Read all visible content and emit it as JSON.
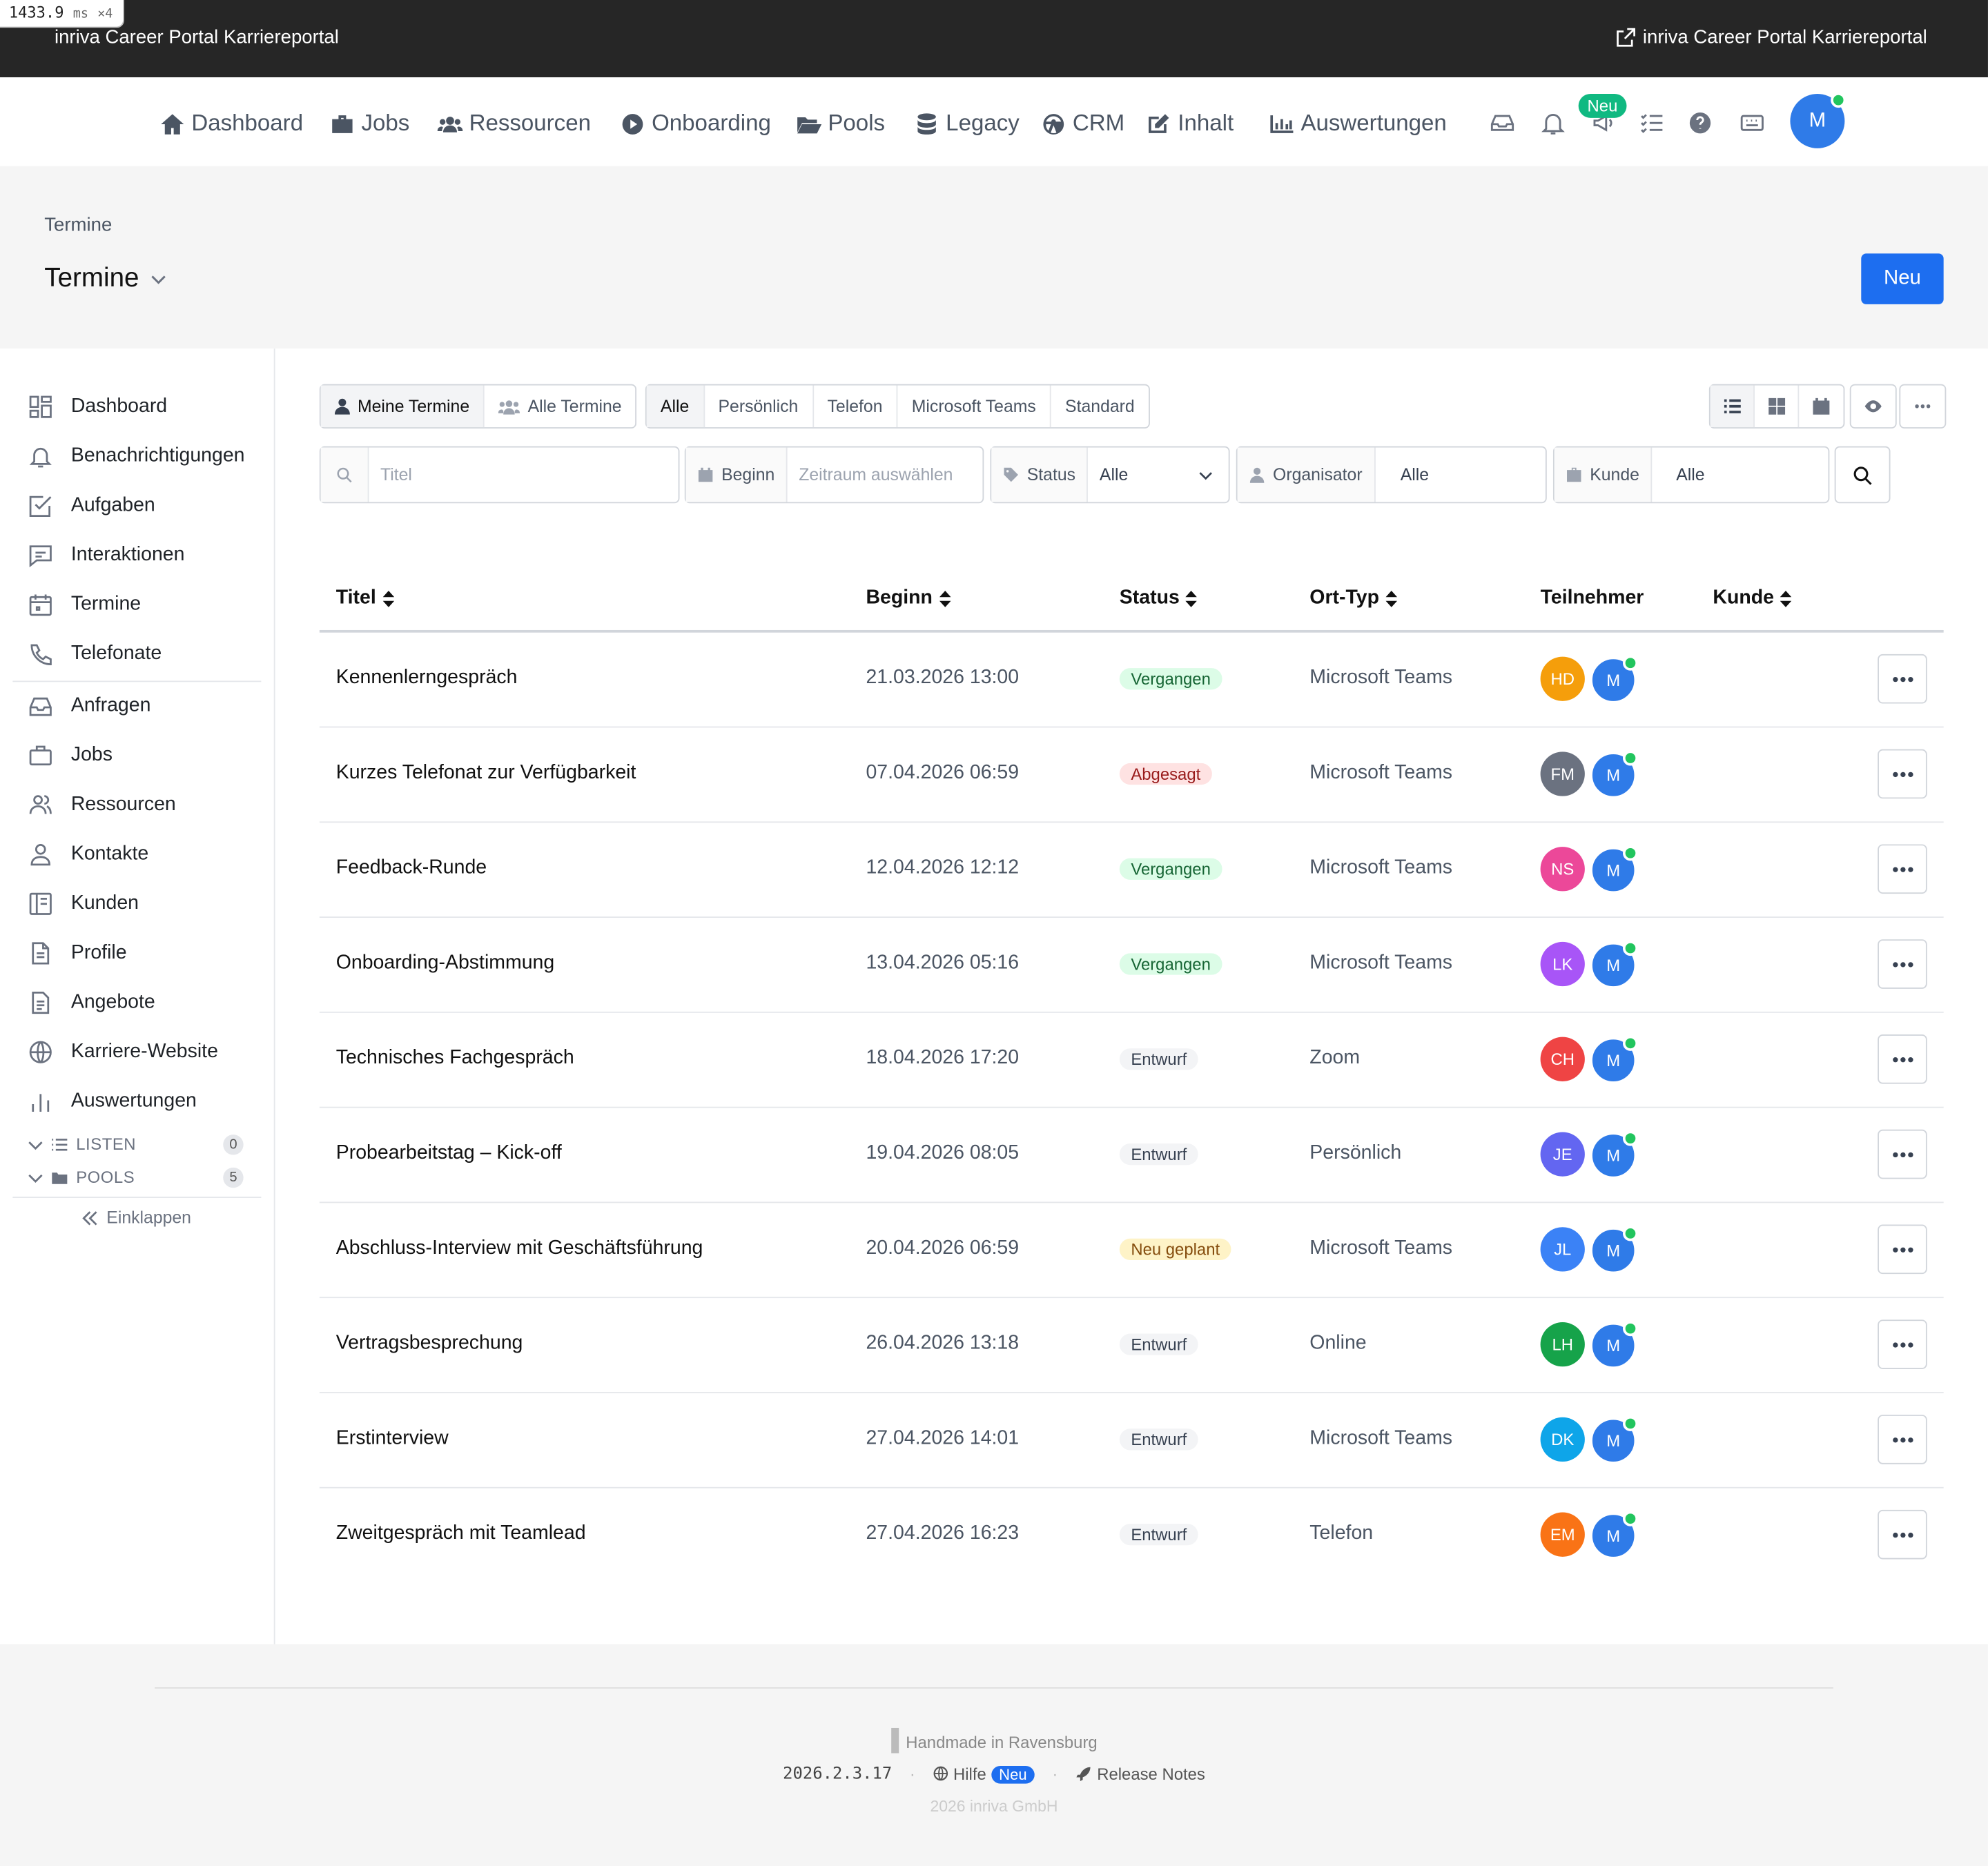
{
  "perf": {
    "value": "1433.9",
    "unit": "ms",
    "mult": "×4"
  },
  "topbar": {
    "brand": "inriva Career Portal Karriereportal",
    "right_link": "inriva Career Portal Karriereportal"
  },
  "nav": {
    "items": [
      "Dashboard",
      "Jobs",
      "Ressourcen",
      "Onboarding",
      "Pools",
      "Legacy",
      "CRM",
      "Inhalt",
      "Auswertungen"
    ],
    "new_badge": "Neu",
    "avatar": "M"
  },
  "header": {
    "breadcrumb": "Termine",
    "title": "Termine",
    "new_button": "Neu"
  },
  "sidebar": {
    "items": [
      "Dashboard",
      "Benachrichtigungen",
      "Aufgaben",
      "Interaktionen",
      "Termine",
      "Telefonate",
      "Anfragen",
      "Jobs",
      "Ressourcen",
      "Kontakte",
      "Kunden",
      "Profile",
      "Angebote",
      "Karriere-Website",
      "Auswertungen"
    ],
    "groups": [
      {
        "label": "LISTEN",
        "count": "0"
      },
      {
        "label": "POOLS",
        "count": "5"
      }
    ],
    "collapse": "Einklappen"
  },
  "toolbar": {
    "scope": [
      "Meine Termine",
      "Alle Termine"
    ],
    "types": [
      "Alle",
      "Persönlich",
      "Telefon",
      "Microsoft Teams",
      "Standard"
    ]
  },
  "filters": {
    "title_placeholder": "Titel",
    "begin_label": "Beginn",
    "begin_placeholder": "Zeitraum auswählen",
    "status_label": "Status",
    "status_value": "Alle",
    "organizer_label": "Organisator",
    "organizer_value": "Alle",
    "customer_label": "Kunde",
    "customer_value": "Alle"
  },
  "table": {
    "columns": [
      "Titel",
      "Beginn",
      "Status",
      "Ort-Typ",
      "Teilnehmer",
      "Kunde"
    ],
    "rows": [
      {
        "title": "Kennenlerngespräch",
        "begin": "21.03.2026 13:00",
        "status": "Vergangen",
        "status_color": "green",
        "ort": "Microsoft Teams",
        "p1": "HD",
        "p1_color": "#f59e0b",
        "p2": "M"
      },
      {
        "title": "Kurzes Telefonat zur Verfügbarkeit",
        "begin": "07.04.2026 06:59",
        "status": "Abgesagt",
        "status_color": "red",
        "ort": "Microsoft Teams",
        "p1": "FM",
        "p1_color": "#6b7280",
        "p2": "M"
      },
      {
        "title": "Feedback-Runde",
        "begin": "12.04.2026 12:12",
        "status": "Vergangen",
        "status_color": "green",
        "ort": "Microsoft Teams",
        "p1": "NS",
        "p1_color": "#ec4899",
        "p2": "M"
      },
      {
        "title": "Onboarding-Abstimmung",
        "begin": "13.04.2026 05:16",
        "status": "Vergangen",
        "status_color": "green",
        "ort": "Microsoft Teams",
        "p1": "LK",
        "p1_color": "#a855f7",
        "p2": "M"
      },
      {
        "title": "Technisches Fachgespräch",
        "begin": "18.04.2026 17:20",
        "status": "Entwurf",
        "status_color": "gray",
        "ort": "Zoom",
        "p1": "CH",
        "p1_color": "#ef4444",
        "p2": "M"
      },
      {
        "title": "Probearbeitstag – Kick-off",
        "begin": "19.04.2026 08:05",
        "status": "Entwurf",
        "status_color": "gray",
        "ort": "Persönlich",
        "p1": "JE",
        "p1_color": "#6366f1",
        "p2": "M"
      },
      {
        "title": "Abschluss-Interview mit Geschäftsführung",
        "begin": "20.04.2026 06:59",
        "status": "Neu geplant",
        "status_color": "yellow",
        "ort": "Microsoft Teams",
        "p1": "JL",
        "p1_color": "#3b82f6",
        "p2": "M"
      },
      {
        "title": "Vertragsbesprechung",
        "begin": "26.04.2026 13:18",
        "status": "Entwurf",
        "status_color": "gray",
        "ort": "Online",
        "p1": "LH",
        "p1_color": "#16a34a",
        "p2": "M"
      },
      {
        "title": "Erstinterview",
        "begin": "27.04.2026 14:01",
        "status": "Entwurf",
        "status_color": "gray",
        "ort": "Microsoft Teams",
        "p1": "DK",
        "p1_color": "#0ea5e9",
        "p2": "M"
      },
      {
        "title": "Zweitgespräch mit Teamlead",
        "begin": "27.04.2026 16:23",
        "status": "Entwurf",
        "status_color": "gray",
        "ort": "Telefon",
        "p1": "EM",
        "p1_color": "#f97316",
        "p2": "M"
      }
    ]
  },
  "footer": {
    "handmade": "Handmade in Ravensburg",
    "version": "2026.2.3.17",
    "help": "Hilfe",
    "help_badge": "Neu",
    "release_notes": "Release Notes",
    "copyright": "2026 inriva GmbH"
  }
}
